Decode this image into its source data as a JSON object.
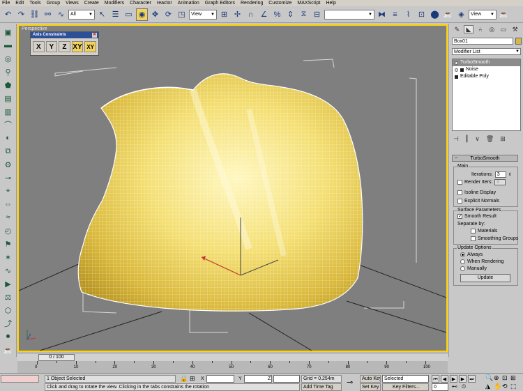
{
  "menu": [
    "File",
    "Edit",
    "Tools",
    "Group",
    "Views",
    "Create",
    "Modifiers",
    "Character",
    "reactor",
    "Animation",
    "Graph Editors",
    "Rendering",
    "Customize",
    "MAXScript",
    "Help"
  ],
  "toolbar": {
    "selection_filter": "All",
    "ref_coord": "View",
    "named_selection": "",
    "view_dropdown": "View"
  },
  "viewport": {
    "label": "Perspective"
  },
  "axis_constraints": {
    "title": "Axis Constraints",
    "buttons": [
      "X",
      "Y",
      "Z",
      "XY",
      "XY"
    ]
  },
  "command_panel": {
    "object_name": "Box01",
    "object_color": "#d7b64a",
    "modifier_list": "Modifier List",
    "stack": [
      "TurboSmooth",
      "Noise",
      "Editable Poly"
    ],
    "turbosmooth": {
      "title": "TurboSmooth",
      "main_group": "Main",
      "iterations_label": "Iterations:",
      "iterations_value": "3",
      "render_iters_label": "Render Iters:",
      "render_iters_value": "0",
      "isoline_label": "Isoline Display",
      "explicit_normals_label": "Explicit Normals",
      "surface_group": "Surface Parameters",
      "smooth_result_label": "Smooth Result",
      "separate_by_label": "Separate by:",
      "materials_label": "Materials",
      "smoothing_groups_label": "Smoothing Groups",
      "update_group": "Update Options",
      "always_label": "Always",
      "when_rendering_label": "When Rendering",
      "manually_label": "Manually",
      "update_button": "Update"
    }
  },
  "timeline": {
    "slider": "0 / 100",
    "ticks": [
      "0",
      "10",
      "20",
      "30",
      "40",
      "50",
      "60",
      "70",
      "80",
      "90",
      "100"
    ]
  },
  "status": {
    "selection": "1 Object Selected",
    "prompt": "Click and drag to rotate the view.  Clicking in the tabs constrains the rotation",
    "x_label": "X",
    "y_label": "Y",
    "z_label": "Z",
    "grid": "Grid = 0.254m",
    "add_time_tag": "Add Time Tag",
    "auto_key": "Auto Key",
    "auto_key_dropdown": "Selected",
    "set_key": "Set Key",
    "key_filters": "Key Filters...",
    "frame": "0"
  }
}
